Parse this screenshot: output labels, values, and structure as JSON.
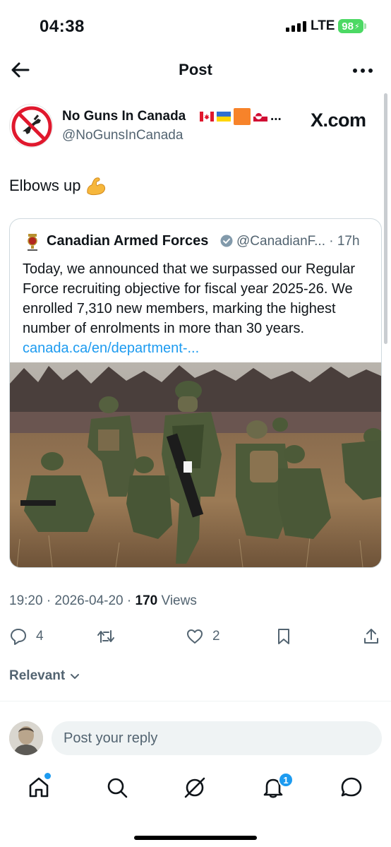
{
  "status_bar": {
    "time": "04:38",
    "network": "LTE",
    "battery": "98"
  },
  "nav": {
    "title": "Post",
    "back_icon": "arrow-left-icon",
    "more_icon": "more-horizontal-icon"
  },
  "author": {
    "name": "No Guns In Canada",
    "handle": "@NoGunsInCanada",
    "flags": [
      "canada-flag",
      "ukraine-flag",
      "orange-square",
      "greenland-flag"
    ],
    "name_ellipsis": "...",
    "watermark": "X.com"
  },
  "post": {
    "text": "Elbows up",
    "emoji": "flexed-biceps-icon"
  },
  "quote": {
    "name": "Canadian Armed Forces",
    "handle": "@CanadianF...",
    "time": "· 17h",
    "text": "Today, we announced that we surpassed our Regular Force recruiting objective for fiscal year 2025-26. We enrolled 7,310 new members, marking the highest number of enrolments in more than 30 years.",
    "link": "canada.ca/en/department-...",
    "image": "soldiers-in-field-photo"
  },
  "meta": {
    "time_date": "19:20 · 2026-04-20 · ",
    "views_count": "170",
    "views_label": " Views"
  },
  "actions": {
    "replies": "4",
    "reposts": "",
    "likes": "2"
  },
  "sort": {
    "label": "Relevant"
  },
  "reply": {
    "placeholder": "Post your reply"
  },
  "bottom_nav": {
    "notifications_badge": "1"
  },
  "colors": {
    "accent": "#1d9bf0",
    "secondary_text": "#536471",
    "battery": "#4cd964"
  }
}
